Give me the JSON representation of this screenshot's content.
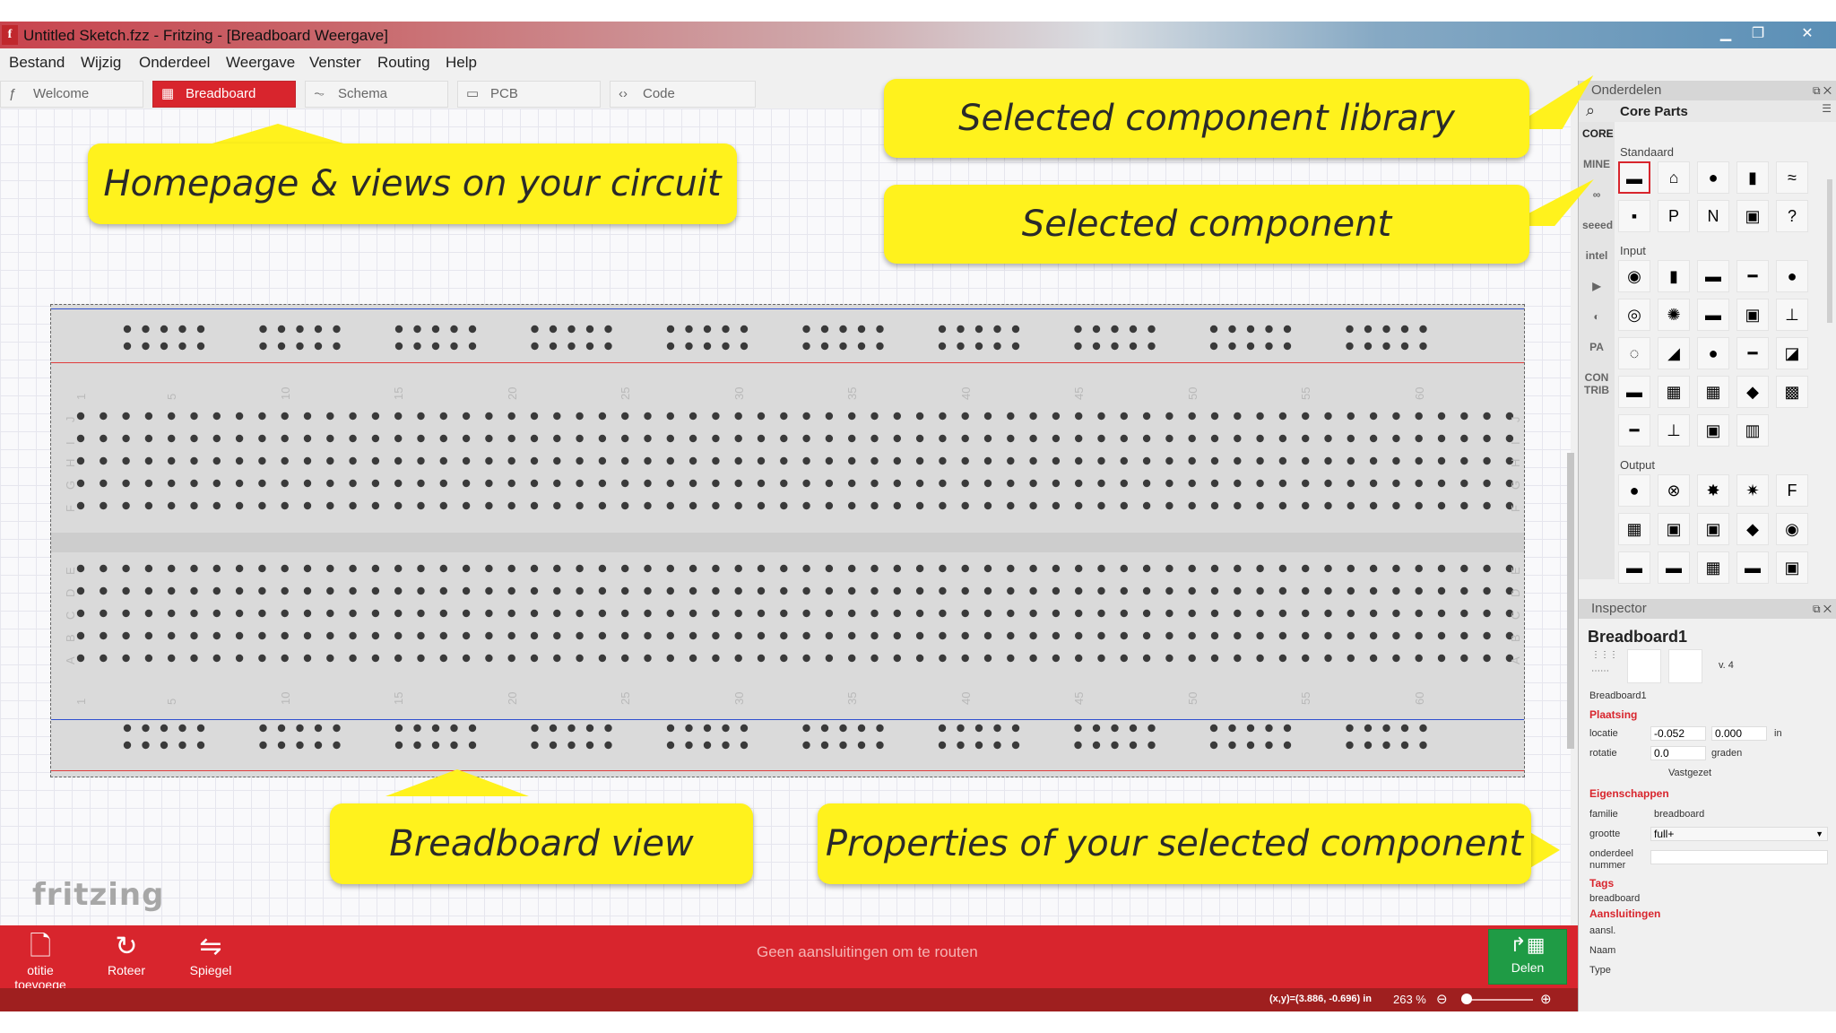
{
  "window": {
    "title": "Untitled Sketch.fzz - Fritzing - [Breadboard Weergave]"
  },
  "menu": [
    "Bestand",
    "Wijzig",
    "Onderdeel",
    "Weergave",
    "Venster",
    "Routing",
    "Help"
  ],
  "tabs": [
    {
      "label": "Welcome",
      "icon": "fritzing-icon",
      "active": false
    },
    {
      "label": "Breadboard",
      "icon": "breadboard-icon",
      "active": true
    },
    {
      "label": "Schema",
      "icon": "schematic-icon",
      "active": false
    },
    {
      "label": "PCB",
      "icon": "pcb-icon",
      "active": false
    },
    {
      "label": "Code",
      "icon": "code-icon",
      "active": false
    }
  ],
  "breadboard": {
    "col_numbers": [
      "1",
      "5",
      "10",
      "15",
      "20",
      "25",
      "30",
      "35",
      "40",
      "45",
      "50",
      "55",
      "60"
    ],
    "row_letters_top": [
      "J",
      "I",
      "H",
      "G",
      "F"
    ],
    "row_letters_bottom": [
      "E",
      "D",
      "C",
      "B",
      "A"
    ],
    "rail_colors": {
      "blue": "#2f4fd0",
      "red": "#e03c3c"
    }
  },
  "logo": "fritzing",
  "toolbar": {
    "buttons": [
      {
        "label": "otitie toevoege",
        "icon": "note-icon"
      },
      {
        "label": "Roteer",
        "icon": "rotate-icon"
      },
      {
        "label": "Spiegel",
        "icon": "flip-icon"
      }
    ],
    "routing_status": "Geen aansluitingen om te routen",
    "share_label": "Delen"
  },
  "statusbar": {
    "coords": "(x,y)=(3.886, -0.696) in",
    "zoom": "263 %"
  },
  "parts_panel": {
    "title": "Onderdelen",
    "bin_title": "Core Parts",
    "bins": [
      "CORE",
      "MINE",
      "∞",
      "seeed",
      "intel",
      "▶",
      "◐",
      "PA",
      "CON TRIB"
    ],
    "sections": [
      {
        "name": "Standaard",
        "rows": [
          [
            "▬",
            "⌂",
            "●",
            "▮",
            "≈"
          ],
          [
            "▪",
            "P",
            "N",
            "▣",
            "?"
          ]
        ]
      },
      {
        "name": "Input",
        "rows": [
          [
            "◉",
            "▮",
            "▬",
            "━",
            "●"
          ],
          [
            "◎",
            "✺",
            "▬",
            "▣",
            "⊥"
          ],
          [
            "◌",
            "◢",
            "●",
            "━",
            "◪"
          ],
          [
            "▬",
            "▦",
            "▦",
            "◆",
            "▩"
          ],
          [
            "━",
            "⊥",
            "▣",
            "▥"
          ]
        ]
      },
      {
        "name": "Output",
        "rows": [
          [
            "●",
            "⊗",
            "✸",
            "✷",
            "F"
          ],
          [
            "▦",
            "▣",
            "▣",
            "◆",
            "◉"
          ],
          [
            "▬",
            "▬",
            "▦",
            "▬",
            "▣"
          ]
        ]
      }
    ]
  },
  "inspector": {
    "title": "Inspector",
    "part_name": "Breadboard1",
    "version": "v. 4",
    "part_label": "Breadboard1",
    "placement_heading": "Plaatsing",
    "location_label": "locatie",
    "location_x": "-0.052",
    "location_y": "0.000",
    "location_unit": "in",
    "rotation_label": "rotatie",
    "rotation_value": "0.0",
    "rotation_unit": "graden",
    "locked_label": "Vastgezet",
    "properties_heading": "Eigenschappen",
    "family_label": "familie",
    "family_value": "breadboard",
    "size_label": "grootte",
    "size_value": "full+",
    "part_number_label": "onderdeel nummer",
    "tags_heading": "Tags",
    "tags_value": "breadboard",
    "connections_heading": "Aansluitingen",
    "conn_label": "aansl.",
    "name_label": "Naam",
    "type_label": "Type"
  },
  "callouts": [
    {
      "text": "Homepage & views on your circuit"
    },
    {
      "text": "Selected component library"
    },
    {
      "text": "Selected component"
    },
    {
      "text": "Breadboard view"
    },
    {
      "text": "Properties of your selected component"
    }
  ],
  "colors": {
    "accent_red": "#d8252d",
    "callout_yellow": "#fff21d",
    "share_green": "#1f9b45"
  }
}
